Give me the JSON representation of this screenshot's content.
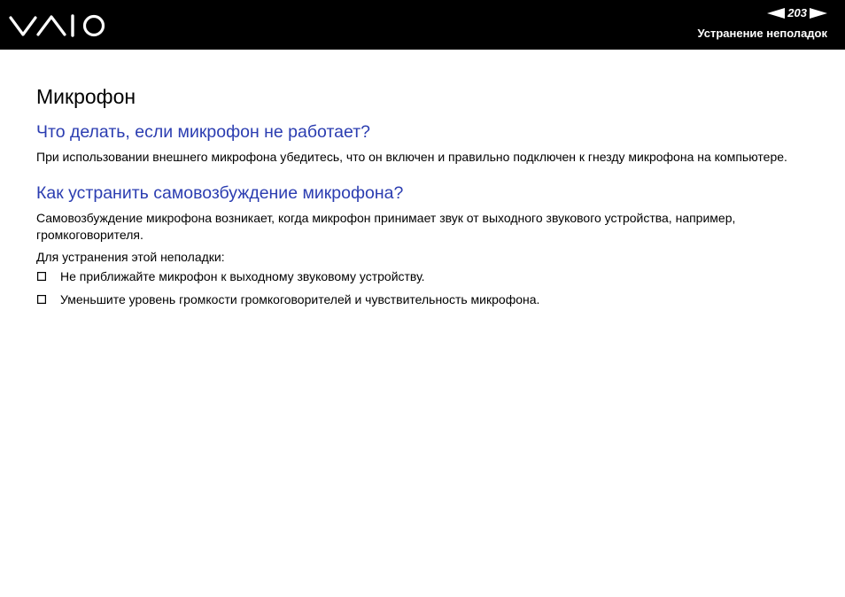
{
  "header": {
    "brand": "VAIO",
    "page_number": "203",
    "section": "Устранение неполадок",
    "icons": {
      "prev": "arrow-left-icon",
      "next": "arrow-right-icon"
    },
    "colors": {
      "background": "#000000",
      "text": "#ffffff"
    }
  },
  "main": {
    "title": "Микрофон",
    "sections": [
      {
        "question": "Что делать, если микрофон не работает?",
        "paragraphs": [
          "При использовании внешнего микрофона убедитесь, что он включен и правильно подключен к гнезду микрофона на компьютере."
        ]
      },
      {
        "question": "Как устранить самовозбуждение микрофона?",
        "paragraphs": [
          "Самовозбуждение микрофона возникает, когда микрофон принимает звук от выходного звукового устройства, например, громкоговорителя.",
          "Для устранения этой неполадки:"
        ],
        "bullets": [
          "Не приближайте микрофон к выходному звуковому устройству.",
          "Уменьшите уровень громкости громкоговорителей и чувствительность микрофона."
        ]
      }
    ],
    "colors": {
      "question": "#2b3db1",
      "text": "#000000"
    }
  }
}
